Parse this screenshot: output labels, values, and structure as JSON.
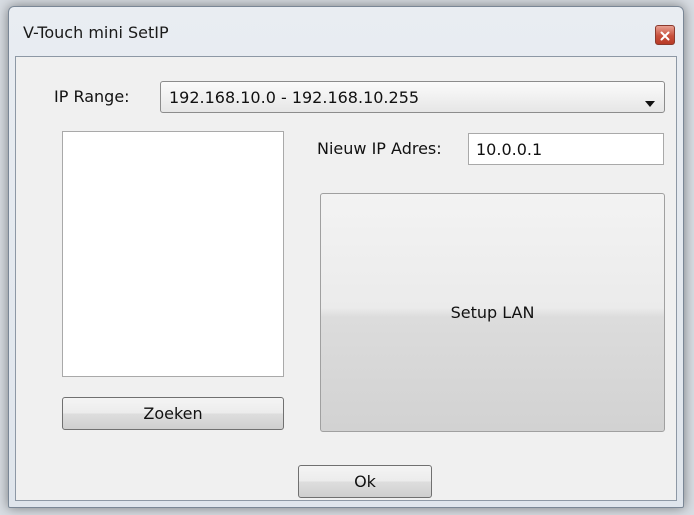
{
  "window": {
    "title": "V-Touch mini SetIP"
  },
  "ip_range": {
    "label": "IP Range:",
    "selected": "192.168.10.0 - 192.168.10.255"
  },
  "new_ip": {
    "label": "Nieuw IP Adres:",
    "value": "10.0.0.1"
  },
  "buttons": {
    "setup_lan": "Setup LAN",
    "zoeken": "Zoeken",
    "ok": "Ok"
  },
  "icons": {
    "close": "close-icon",
    "dropdown": "chevron-down-icon"
  },
  "colors": {
    "close_button": "#c8503c",
    "client_background": "#f0f0f0"
  }
}
